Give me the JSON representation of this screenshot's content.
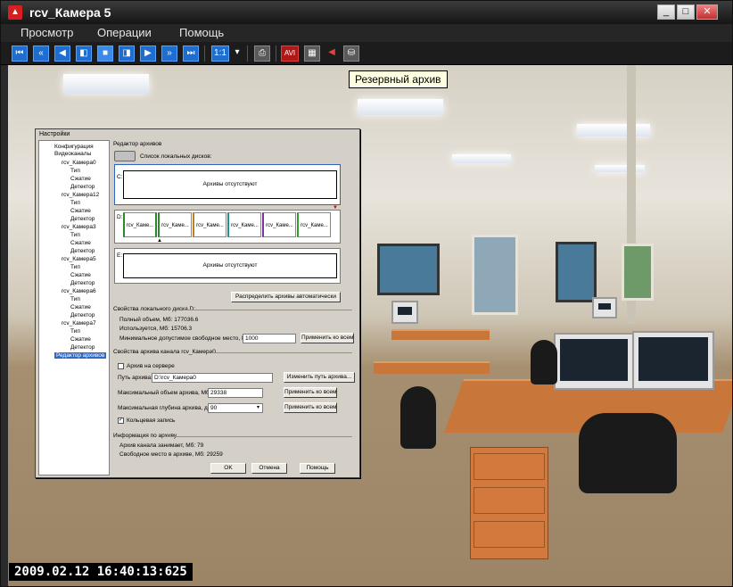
{
  "window": {
    "title": "rcv_Камера 5",
    "minimize": "_",
    "maximize": "□",
    "close": "✕"
  },
  "menu": [
    "Просмотр",
    "Операции",
    "Помощь"
  ],
  "toolbar": {
    "zoom_label": "1:1",
    "avi_label": "AVI",
    "tooltip": "Резервный архив"
  },
  "video": {
    "timestamp": "2009.02.12 16:40:13:625"
  },
  "dialog": {
    "title": "Настройки",
    "tree": [
      "Конфигурация",
      "Видеоканалы",
      "rcv_Камера0",
      "Тип",
      "Сжатие",
      "Детектор",
      "rcv_Камера12",
      "Тип",
      "Сжатие",
      "Детектор",
      "rcv_Камера3",
      "Тип",
      "Сжатие",
      "Детектор",
      "rcv_Камера5",
      "Тип",
      "Сжатие",
      "Детектор",
      "rcv_Камера6",
      "Тип",
      "Сжатие",
      "Детектор",
      "rcv_Камера7",
      "Тип",
      "Сжатие",
      "Детектор",
      "Редактор архивов"
    ],
    "editor_title": "Редактор архивов",
    "disks_label": "Список локальных дисков:",
    "disk_c": {
      "letter": "C:",
      "text": "Архивы отсутствуют"
    },
    "disk_d": {
      "letter": "D:",
      "segments": [
        "rcv_Каме...",
        "rcv_Каме...",
        "rcv_Каме...",
        "rcv_Каме...",
        "rcv_Каме...",
        "rcv_Каме..."
      ]
    },
    "disk_e": {
      "letter": "E:",
      "text": "Архивы отсутствуют"
    },
    "auto_distribute": "Распределить архивы автоматически",
    "local_disk_props": "Свойства локального диска D:",
    "full_volume": "Полный объем, Мб: 177036.6",
    "used": "Используется, Мб: 15706.3",
    "min_free_label": "Минимальное допустимое свободное место, Мб:",
    "min_free_value": "1000",
    "apply_all_1": "Применить ко всем",
    "channel_props": "Свойства архива канала rcv_Камера0",
    "archive_on_server": "Архив на сервере",
    "path_label": "Путь архива:",
    "path_value": "D:\\rcv_Камера0",
    "change_path": "Изменить путь архива...",
    "max_volume_label": "Максимальный объем архива, Мб:",
    "max_volume_value": "29338",
    "apply_all_2": "Применить ко всем",
    "max_depth_label": "Максимальная глубина архива, дн:",
    "max_depth_value": "90",
    "apply_all_3": "Применить ко всем",
    "ring_record": "Кольцевая запись",
    "archive_info": "Информация по архиву",
    "channel_occupies": "Архив канала занимает, Мб: 79",
    "free_space": "Свободное место в архиве, Мб: 29259",
    "ok": "OK",
    "cancel": "Отмена",
    "help": "Помощь"
  }
}
